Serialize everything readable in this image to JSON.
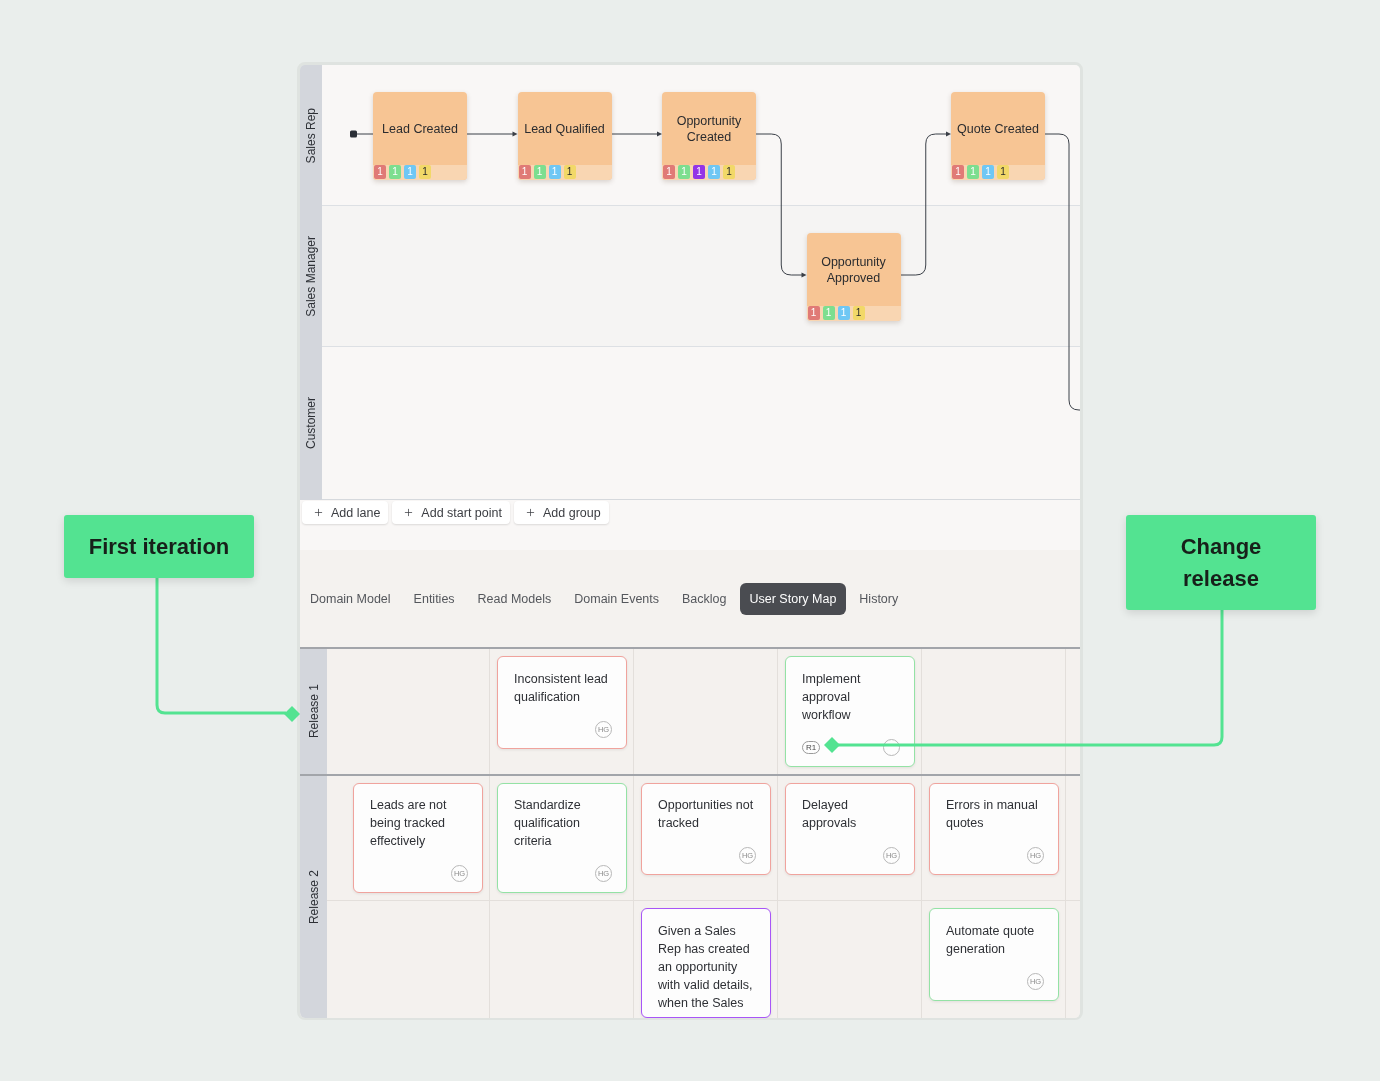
{
  "event_flow": {
    "lanes": [
      {
        "name": "Sales Rep",
        "slots": [
          {
            "kind": "event",
            "label": "Lead Created",
            "tags": [
              {
                "count": "1",
                "color": "#e07a76"
              },
              {
                "count": "1",
                "color": "#7dde8f"
              },
              {
                "count": "1",
                "color": "#6fc7f4"
              },
              {
                "count": "1",
                "color": "#f2d868"
              }
            ]
          },
          {
            "kind": "event",
            "label": "Lead Qualified",
            "tags": [
              {
                "count": "1",
                "color": "#e07a76"
              },
              {
                "count": "1",
                "color": "#7dde8f"
              },
              {
                "count": "1",
                "color": "#6fc7f4"
              },
              {
                "count": "1",
                "color": "#f2d868"
              }
            ]
          },
          {
            "kind": "event",
            "label": "Opportunity Created",
            "tags": [
              {
                "count": "1",
                "color": "#e07a76"
              },
              {
                "count": "1",
                "color": "#7dde8f"
              },
              {
                "count": "1",
                "color": "#9334e6"
              },
              {
                "count": "1",
                "color": "#6fc7f4"
              },
              {
                "count": "1",
                "color": "#f2d868"
              }
            ]
          },
          {
            "kind": "empty"
          },
          {
            "kind": "event",
            "label": "Quote Created",
            "tags": [
              {
                "count": "1",
                "color": "#e07a76"
              },
              {
                "count": "1",
                "color": "#7dde8f"
              },
              {
                "count": "1",
                "color": "#6fc7f4"
              },
              {
                "count": "1",
                "color": "#f2d868"
              }
            ]
          }
        ]
      },
      {
        "name": "Sales Manager",
        "slots": [
          {
            "kind": "empty"
          },
          {
            "kind": "empty"
          },
          {
            "kind": "empty"
          },
          {
            "kind": "event",
            "label": "Opportunity Approved",
            "tags": [
              {
                "count": "1",
                "color": "#e07a76"
              },
              {
                "count": "1",
                "color": "#7dde8f"
              },
              {
                "count": "1",
                "color": "#6fc7f4"
              },
              {
                "count": "1",
                "color": "#f2d868"
              }
            ]
          }
        ]
      },
      {
        "name": "Customer"
      }
    ]
  },
  "canvas_actions": [
    {
      "label": "Add lane"
    },
    {
      "label": "Add start point"
    },
    {
      "label": "Add group"
    }
  ],
  "tabs": [
    {
      "label": "Domain Model",
      "selected": false
    },
    {
      "label": "Entities",
      "selected": false
    },
    {
      "label": "Read Models",
      "selected": false
    },
    {
      "label": "Domain Events",
      "selected": false
    },
    {
      "label": "Backlog",
      "selected": false
    },
    {
      "label": "User Story Map",
      "selected": true
    },
    {
      "label": "History",
      "selected": false
    }
  ],
  "story_map": {
    "releases": [
      {
        "name": "Release 1",
        "lines": [
          {
            "cells": [
              {
                "kind": "empty"
              },
              {
                "kind": "problem",
                "text": "Inconsistent lead qualification",
                "initials": "HG"
              },
              {
                "kind": "empty"
              },
              {
                "kind": "solution",
                "text": "Implement approval workflow",
                "release_tag": "R1",
                "has_avatar": true
              },
              {
                "kind": "empty"
              }
            ]
          }
        ]
      },
      {
        "name": "Release 2",
        "lines": [
          {
            "cells": [
              {
                "kind": "problem",
                "text": "Leads are not being tracked effectively",
                "initials": "HG"
              },
              {
                "kind": "solution",
                "text": "Standardize qualification criteria",
                "initials": "HG"
              },
              {
                "kind": "problem",
                "text": "Opportunities not tracked",
                "initials": "HG"
              },
              {
                "kind": "problem",
                "text": "Delayed approvals",
                "initials": "HG"
              },
              {
                "kind": "problem",
                "text": "Errors in manual quotes",
                "initials": "HG"
              }
            ]
          },
          {
            "cells": [
              {
                "kind": "empty"
              },
              {
                "kind": "empty"
              },
              {
                "kind": "story",
                "text": "Given a Sales Rep has created an opportunity with valid details, when the Sales"
              },
              {
                "kind": "empty"
              },
              {
                "kind": "solution",
                "text": "Automate quote generation",
                "initials": "HG"
              }
            ]
          }
        ]
      }
    ]
  },
  "callouts": [
    {
      "kind": "left",
      "text": "First iteration"
    },
    {
      "kind": "right",
      "text": "Change release"
    }
  ]
}
